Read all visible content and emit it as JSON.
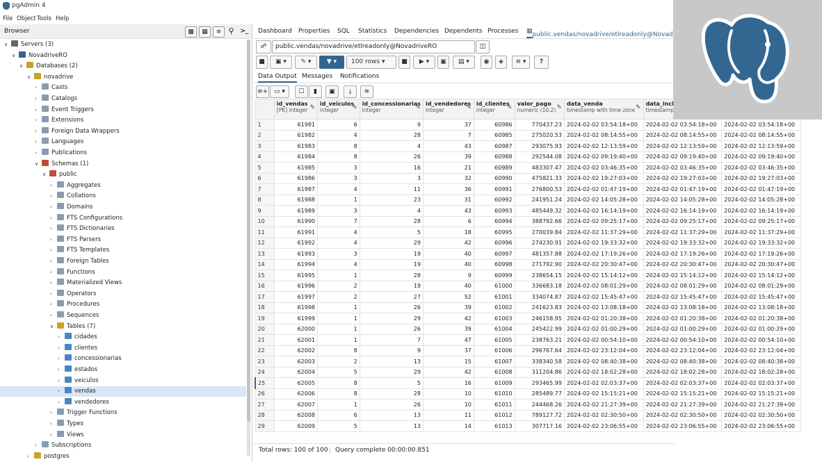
{
  "window": {
    "title": "pgAdmin 4"
  },
  "menu": [
    "File",
    "Object",
    "Tools",
    "Help"
  ],
  "browser": {
    "label": "Browser",
    "tree": [
      {
        "label": "Servers (3)",
        "depth": 0,
        "icon": "servers-icon",
        "open": true
      },
      {
        "label": "NovadriveRO",
        "depth": 1,
        "icon": "server-icon",
        "open": true
      },
      {
        "label": "Databases (2)",
        "depth": 2,
        "icon": "databases-icon",
        "open": true
      },
      {
        "label": "novadrive",
        "depth": 3,
        "icon": "database-icon",
        "open": true
      },
      {
        "label": "Casts",
        "depth": 4,
        "icon": "casts-icon",
        "open": false
      },
      {
        "label": "Catalogs",
        "depth": 4,
        "icon": "catalogs-icon",
        "open": false
      },
      {
        "label": "Event Triggers",
        "depth": 4,
        "icon": "event-triggers-icon",
        "open": false
      },
      {
        "label": "Extensions",
        "depth": 4,
        "icon": "extensions-icon",
        "open": false
      },
      {
        "label": "Foreign Data Wrappers",
        "depth": 4,
        "icon": "fdw-icon",
        "open": false
      },
      {
        "label": "Languages",
        "depth": 4,
        "icon": "languages-icon",
        "open": false
      },
      {
        "label": "Publications",
        "depth": 4,
        "icon": "publications-icon",
        "open": false
      },
      {
        "label": "Schemas (1)",
        "depth": 4,
        "icon": "schemas-icon",
        "open": true
      },
      {
        "label": "public",
        "depth": 5,
        "icon": "schema-icon",
        "open": true
      },
      {
        "label": "Aggregates",
        "depth": 6,
        "icon": "aggregates-icon",
        "open": false
      },
      {
        "label": "Collations",
        "depth": 6,
        "icon": "collations-icon",
        "open": false
      },
      {
        "label": "Domains",
        "depth": 6,
        "icon": "domains-icon",
        "open": false
      },
      {
        "label": "FTS Configurations",
        "depth": 6,
        "icon": "fts-config-icon",
        "open": false
      },
      {
        "label": "FTS Dictionaries",
        "depth": 6,
        "icon": "fts-dict-icon",
        "open": false
      },
      {
        "label": "FTS Parsers",
        "depth": 6,
        "icon": "fts-parsers-icon",
        "open": false
      },
      {
        "label": "FTS Templates",
        "depth": 6,
        "icon": "fts-templates-icon",
        "open": false
      },
      {
        "label": "Foreign Tables",
        "depth": 6,
        "icon": "foreign-tables-icon",
        "open": false
      },
      {
        "label": "Functions",
        "depth": 6,
        "icon": "functions-icon",
        "open": false
      },
      {
        "label": "Materialized Views",
        "depth": 6,
        "icon": "mat-views-icon",
        "open": false
      },
      {
        "label": "Operators",
        "depth": 6,
        "icon": "operators-icon",
        "open": false
      },
      {
        "label": "Procedures",
        "depth": 6,
        "icon": "procedures-icon",
        "open": false
      },
      {
        "label": "Sequences",
        "depth": 6,
        "icon": "sequences-icon",
        "open": false
      },
      {
        "label": "Tables (7)",
        "depth": 6,
        "icon": "tables-icon",
        "open": true
      },
      {
        "label": "cidades",
        "depth": 7,
        "icon": "table-icon",
        "open": false
      },
      {
        "label": "clientes",
        "depth": 7,
        "icon": "table-icon",
        "open": false
      },
      {
        "label": "concessionarias",
        "depth": 7,
        "icon": "table-icon",
        "open": false
      },
      {
        "label": "estados",
        "depth": 7,
        "icon": "table-icon",
        "open": false
      },
      {
        "label": "veiculos",
        "depth": 7,
        "icon": "table-icon",
        "open": false
      },
      {
        "label": "vendas",
        "depth": 7,
        "icon": "table-icon",
        "open": false,
        "selected": true
      },
      {
        "label": "vendedores",
        "depth": 7,
        "icon": "table-icon",
        "open": false
      },
      {
        "label": "Trigger Functions",
        "depth": 6,
        "icon": "trigger-functions-icon",
        "open": false
      },
      {
        "label": "Types",
        "depth": 6,
        "icon": "types-icon",
        "open": false
      },
      {
        "label": "Views",
        "depth": 6,
        "icon": "views-icon",
        "open": false
      },
      {
        "label": "Subscriptions",
        "depth": 4,
        "icon": "subscriptions-icon",
        "open": false
      },
      {
        "label": "postgres",
        "depth": 3,
        "icon": "database-icon",
        "open": false
      }
    ]
  },
  "tabs": [
    "Dashboard",
    "Properties",
    "SQL",
    "Statistics",
    "Dependencies",
    "Dependents",
    "Processes",
    "public.vendas/novadrive/etlreadonly@Novadrive"
  ],
  "query_tool": {
    "connection": "public.vendas/novadrive/etlreadonly@NovadriveRO",
    "rows_limit": "100 rows"
  },
  "subtabs": [
    "Data Output",
    "Messages",
    "Notifications"
  ],
  "columns": [
    {
      "name": "id_vendas",
      "type": "[PK] integer"
    },
    {
      "name": "id_veiculos",
      "type": "integer"
    },
    {
      "name": "id_concessionarias",
      "type": "integer"
    },
    {
      "name": "id_vendedores",
      "type": "integer"
    },
    {
      "name": "id_clientes",
      "type": "integer"
    },
    {
      "name": "valor_pago",
      "type": "numeric (10,2)"
    },
    {
      "name": "data_venda",
      "type": "timestamp with time zone"
    },
    {
      "name": "data_inclu",
      "type": "timestamp"
    },
    {
      "name": "",
      "type": ""
    }
  ],
  "rows": [
    [
      "1",
      "61981",
      "6",
      "9",
      "37",
      "60986",
      "770437.23",
      "2024-02-02 03:54:18+00",
      "2024-02-02 03:54:18+00",
      "2024-02-02 03:54:18+00"
    ],
    [
      "2",
      "61982",
      "4",
      "28",
      "7",
      "60985",
      "275020.53",
      "2024-02-02 08:14:55+00",
      "2024-02-02 08:14:55+00",
      "2024-02-02 08:14:55+00"
    ],
    [
      "3",
      "61983",
      "8",
      "4",
      "43",
      "60987",
      "293075.93",
      "2024-02-02 12:13:59+00",
      "2024-02-02 12:13:59+00",
      "2024-02-02 12:13:59+00"
    ],
    [
      "4",
      "61984",
      "8",
      "26",
      "39",
      "60988",
      "292544.08",
      "2024-02-02 09:19:40+00",
      "2024-02-02 09:19:40+00",
      "2024-02-02 09:19:40+00"
    ],
    [
      "5",
      "61985",
      "3",
      "16",
      "21",
      "60989",
      "483307.47",
      "2024-02-02 03:46:35+00",
      "2024-02-02 03:46:35+00",
      "2024-02-02 03:46:35+00"
    ],
    [
      "6",
      "61986",
      "3",
      "3",
      "32",
      "60990",
      "475821.33",
      "2024-02-02 19:27:03+00",
      "2024-02-02 19:27:03+00",
      "2024-02-02 19:27:03+00"
    ],
    [
      "7",
      "61987",
      "4",
      "11",
      "36",
      "60991",
      "276800.53",
      "2024-02-02 01:47:19+00",
      "2024-02-02 01:47:19+00",
      "2024-02-02 01:47:19+00"
    ],
    [
      "8",
      "61988",
      "1",
      "23",
      "31",
      "60992",
      "241951.24",
      "2024-02-02 14:05:28+00",
      "2024-02-02 14:05:28+00",
      "2024-02-02 14:05:28+00"
    ],
    [
      "9",
      "61989",
      "3",
      "4",
      "43",
      "60993",
      "485449.32",
      "2024-02-02 16:14:19+00",
      "2024-02-02 16:14:19+00",
      "2024-02-02 16:14:19+00"
    ],
    [
      "10",
      "61990",
      "7",
      "28",
      "6",
      "60994",
      "388792.66",
      "2024-02-02 09:25:17+00",
      "2024-02-02 09:25:17+00",
      "2024-02-02 09:25:17+00"
    ],
    [
      "11",
      "61991",
      "4",
      "5",
      "18",
      "60995",
      "270039.84",
      "2024-02-02 11:37:29+00",
      "2024-02-02 11:37:29+00",
      "2024-02-02 11:37:29+00"
    ],
    [
      "12",
      "61992",
      "4",
      "29",
      "42",
      "60996",
      "274230.91",
      "2024-02-02 19:33:32+00",
      "2024-02-02 19:33:32+00",
      "2024-02-02 19:33:32+00"
    ],
    [
      "13",
      "61993",
      "3",
      "19",
      "40",
      "60997",
      "481357.88",
      "2024-02-02 17:19:26+00",
      "2024-02-02 17:19:26+00",
      "2024-02-02 17:19:26+00"
    ],
    [
      "14",
      "61994",
      "4",
      "19",
      "40",
      "60998",
      "271792.90",
      "2024-02-02 20:30:47+00",
      "2024-02-02 20:30:47+00",
      "2024-02-02 20:30:47+00"
    ],
    [
      "15",
      "61995",
      "1",
      "28",
      "9",
      "60999",
      "238654.15",
      "2024-02-02 15:14:12+00",
      "2024-02-02 15:14:12+00",
      "2024-02-02 15:14:12+00"
    ],
    [
      "16",
      "61996",
      "2",
      "19",
      "40",
      "61000",
      "336683.18",
      "2024-02-02 08:01:29+00",
      "2024-02-02 08:01:29+00",
      "2024-02-02 08:01:29+00"
    ],
    [
      "17",
      "61997",
      "2",
      "27",
      "52",
      "61001",
      "334074.87",
      "2024-02-02 15:45:47+00",
      "2024-02-02 15:45:47+00",
      "2024-02-02 15:45:47+00"
    ],
    [
      "18",
      "61998",
      "1",
      "26",
      "39",
      "61002",
      "241623.83",
      "2024-02-02 13:08:18+00",
      "2024-02-02 13:08:18+00",
      "2024-02-02 13:08:18+00"
    ],
    [
      "19",
      "61999",
      "1",
      "29",
      "42",
      "61003",
      "246158.95",
      "2024-02-02 01:20:38+00",
      "2024-02-02 01:20:38+00",
      "2024-02-02 01:20:38+00"
    ],
    [
      "20",
      "62000",
      "1",
      "26",
      "39",
      "61004",
      "245422.99",
      "2024-02-02 01:00:29+00",
      "2024-02-02 01:00:29+00",
      "2024-02-02 01:00:29+00"
    ],
    [
      "21",
      "62001",
      "1",
      "7",
      "47",
      "61005",
      "238763.21",
      "2024-02-02 00:54:10+00",
      "2024-02-02 00:54:10+00",
      "2024-02-02 00:54:10+00"
    ],
    [
      "22",
      "62002",
      "8",
      "9",
      "37",
      "61006",
      "296767.64",
      "2024-02-02 23:12:04+00",
      "2024-02-02 23:12:04+00",
      "2024-02-02 23:12:04+00"
    ],
    [
      "23",
      "62003",
      "2",
      "13",
      "15",
      "61007",
      "338340.58",
      "2024-02-02 08:40:38+00",
      "2024-02-02 08:40:38+00",
      "2024-02-02 08:40:38+00"
    ],
    [
      "24",
      "62004",
      "5",
      "29",
      "42",
      "61008",
      "311204.86",
      "2024-02-02 18:02:28+00",
      "2024-02-02 18:02:28+00",
      "2024-02-02 18:02:28+00"
    ],
    [
      "25",
      "62005",
      "8",
      "5",
      "16",
      "61009",
      "293465.99",
      "2024-02-02 02:03:37+00",
      "2024-02-02 02:03:37+00",
      "2024-02-02 02:03:37+00"
    ],
    [
      "26",
      "62006",
      "8",
      "28",
      "10",
      "61010",
      "285489.77",
      "2024-02-02 15:15:21+00",
      "2024-02-02 15:15:21+00",
      "2024-02-02 15:15:21+00"
    ],
    [
      "27",
      "62007",
      "1",
      "26",
      "10",
      "61011",
      "244468.26",
      "2024-02-02 21:27:39+00",
      "2024-02-02 21:27:39+00",
      "2024-02-02 21:27:39+00"
    ],
    [
      "28",
      "62008",
      "6",
      "13",
      "11",
      "61012",
      "789127.72",
      "2024-02-02 02:30:50+00",
      "2024-02-02 02:30:50+00",
      "2024-02-02 02:30:50+00"
    ],
    [
      "29",
      "62009",
      "5",
      "13",
      "14",
      "61013",
      "307717.16",
      "2024-02-02 23:06:55+00",
      "2024-02-02 23:06:55+00",
      "2024-02-02 23:06:55+00"
    ]
  ],
  "status": {
    "total_rows": "Total rows: 100 of 100",
    "query": "Query complete 00:00:00.851"
  },
  "colors": {
    "brand": "#326690",
    "selected_row": "#d8e6f6"
  }
}
